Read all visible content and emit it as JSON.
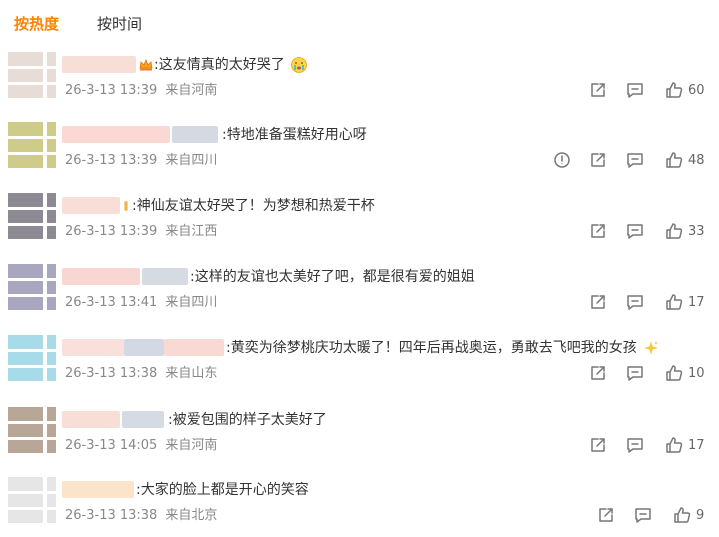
{
  "tabs": {
    "hot": "按热度",
    "time": "按时间"
  },
  "comments": [
    {
      "text": ":这友情真的太好哭了",
      "time": "26-3-13 13:39",
      "location": "来自河南",
      "likes": "60",
      "avatar_color": "#e8ddd6",
      "report": false
    },
    {
      "text": ":特地准备蛋糕好用心呀",
      "time": "26-3-13 13:39",
      "location": "来自四川",
      "likes": "48",
      "avatar_color": "#cfcc8a",
      "report": true
    },
    {
      "text": ":神仙友谊太好哭了！为梦想和热爱干杯",
      "time": "26-3-13 13:39",
      "location": "来自江西",
      "likes": "33",
      "avatar_color": "#8d8a93",
      "report": false
    },
    {
      "text": ":这样的友谊也太美好了吧，都是很有爱的姐姐",
      "time": "26-3-13 13:41",
      "location": "来自四川",
      "likes": "17",
      "avatar_color": "#a9a7bf",
      "report": false
    },
    {
      "text": ":黄奕为徐梦桃庆功太暖了！四年后再战奥运，勇敢去飞吧我的女孩",
      "time": "26-3-13 13:38",
      "location": "来自山东",
      "likes": "10",
      "avatar_color": "#a8dbe8",
      "report": false
    },
    {
      "text": ":被爱包围的样子太美好了",
      "time": "26-3-13 14:05",
      "location": "来自河南",
      "likes": "17",
      "avatar_color": "#b8a697",
      "report": false
    },
    {
      "text": ":大家的脸上都是开心的笑容",
      "time": "26-3-13 13:38",
      "location": "来自北京",
      "likes": "9",
      "avatar_color": "#e6e6e6",
      "report": false
    }
  ]
}
